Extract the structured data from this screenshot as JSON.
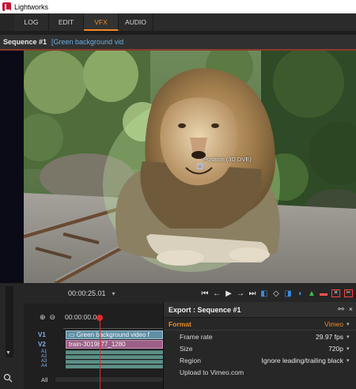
{
  "window": {
    "title": "Lightworks"
  },
  "tabs": [
    {
      "label": "LOG"
    },
    {
      "label": "EDIT"
    },
    {
      "label": "VFX"
    },
    {
      "label": "AUDIO"
    }
  ],
  "active_tab": "VFX",
  "sequence": {
    "title": "Sequence #1",
    "name": "[Green background vid"
  },
  "viewer": {
    "position_label": "Position (3D DVE)"
  },
  "transport": {
    "timecode": "00:00:25.01",
    "tc_arrow": "▾"
  },
  "timeline": {
    "timecode": "00:00:00.0",
    "tracks": {
      "v1": "V1",
      "v2": "V2",
      "a1": "A1",
      "a2": "A2",
      "a3": "A3",
      "a4": "A4"
    },
    "clip_v1": "Green background video f",
    "clip_v2": "train-3019877_1280",
    "all_label": "All"
  },
  "export": {
    "title": "Export : Sequence #1",
    "format_label": "Format",
    "format_value": "Vimeo",
    "rows": [
      {
        "label": "Frame rate",
        "value": "29.97 fps"
      },
      {
        "label": "Size",
        "value": "720p"
      },
      {
        "label": "Region",
        "value": "Ignore leading/trailing black"
      },
      {
        "label": "Upload to Vimeo.com",
        "value": ""
      }
    ]
  },
  "colors": {
    "accent": "#f08a24",
    "playhead": "#e0292a",
    "clip_v1": "#5f8fa6",
    "clip_v2": "#9c5f87"
  }
}
